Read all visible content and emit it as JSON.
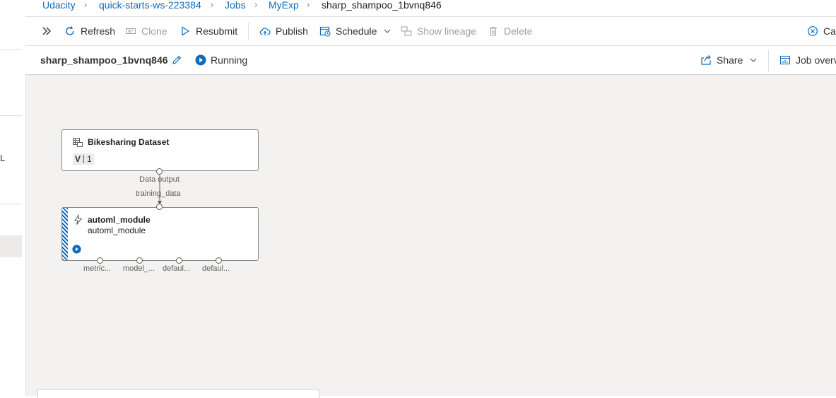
{
  "nav": {
    "clipped_label": "L"
  },
  "breadcrumb": {
    "items": [
      "Udacity",
      "quick-starts-ws-223384",
      "Jobs",
      "MyExp"
    ],
    "current": "sharp_shampoo_1bvnq846"
  },
  "toolbar": {
    "refresh": "Refresh",
    "clone": "Clone",
    "resubmit": "Resubmit",
    "publish": "Publish",
    "schedule": "Schedule",
    "show_lineage": "Show lineage",
    "delete": "Delete",
    "cancel": "Ca"
  },
  "jobbar": {
    "name": "sharp_shampoo_1bvnq846",
    "status": "Running",
    "share": "Share",
    "overview": "Job overv"
  },
  "canvas": {
    "dataset_node": {
      "title": "Bikesharing Dataset",
      "version_prefix": "V",
      "version": "1",
      "output_label": "Data output"
    },
    "edge_label": "training_data",
    "automl_node": {
      "title": "automl_module",
      "subtitle": "automl_module",
      "outputs": [
        "metric...",
        "model_...",
        "defaul...",
        "defaul..."
      ]
    }
  },
  "colors": {
    "accent": "#0f6cbd",
    "canvas_bg": "#f3f2f1"
  }
}
